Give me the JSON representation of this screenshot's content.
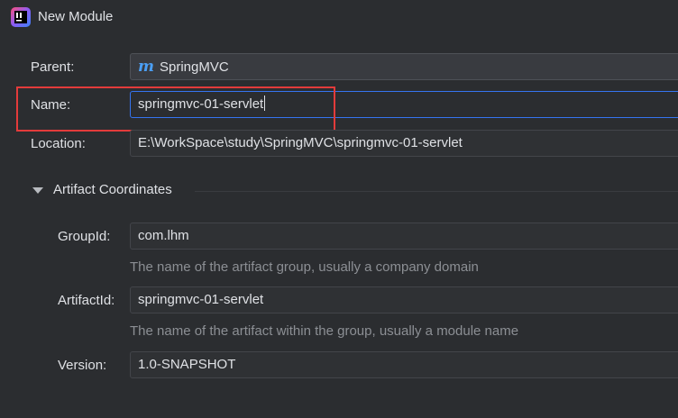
{
  "window": {
    "title": "New Module",
    "icon": "intellij-idea-icon"
  },
  "form": {
    "parent": {
      "label": "Parent:",
      "value": "SpringMVC",
      "icon": "maven-module-icon"
    },
    "name": {
      "label": "Name:",
      "value": "springmvc-01-servlet"
    },
    "location": {
      "label": "Location:",
      "value": "E:\\WorkSpace\\study\\SpringMVC\\springmvc-01-servlet"
    }
  },
  "artifact_coordinates": {
    "section_label": "Artifact Coordinates",
    "expanded": true,
    "group_id": {
      "label": "GroupId:",
      "value": "com.lhm",
      "hint": "The name of the artifact group, usually a company domain"
    },
    "artifact_id": {
      "label": "ArtifactId:",
      "value": "springmvc-01-servlet",
      "hint": "The name of the artifact within the group, usually a module name"
    },
    "version": {
      "label": "Version:",
      "value": "1.0-SNAPSHOT"
    }
  },
  "colors": {
    "background": "#2b2d30",
    "focus_border": "#3574f0",
    "annotation_box": "#e33b3b",
    "maven_icon": "#4b9ff5"
  }
}
